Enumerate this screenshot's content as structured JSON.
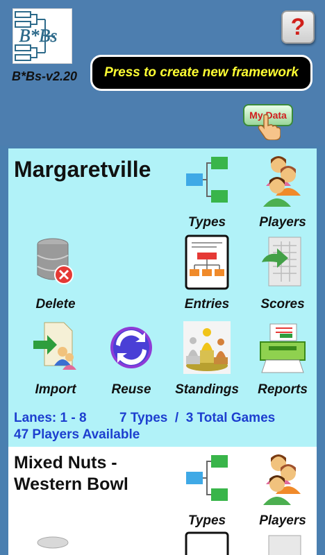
{
  "header": {
    "logo_text": "B*Bs",
    "version": "B*Bs-v2.20",
    "help_label": "?",
    "create_label": "Press to create new framework",
    "mydata_label": "My Data"
  },
  "framework1": {
    "name": "Margaretville",
    "tiles": {
      "types": "Types",
      "players": "Players",
      "delete": "Delete",
      "entries": "Entries",
      "scores": "Scores",
      "import": "Import",
      "reuse": "Reuse",
      "standings": "Standings",
      "reports": "Reports"
    },
    "lanes": "Lanes: 1 - 8",
    "games": "7 Types  /  3 Total Games",
    "players_available": "47 Players Available"
  },
  "framework2": {
    "name_line1": "Mixed Nuts -",
    "name_line2": "Western Bowl",
    "tiles": {
      "types": "Types",
      "players": "Players"
    }
  },
  "colors": {
    "header_bg": "#4d7eaf",
    "panel_active": "#b1f2f8",
    "panel_inactive": "#ffffff",
    "create_text": "#ffff33",
    "info_text": "#1d3fcf"
  }
}
